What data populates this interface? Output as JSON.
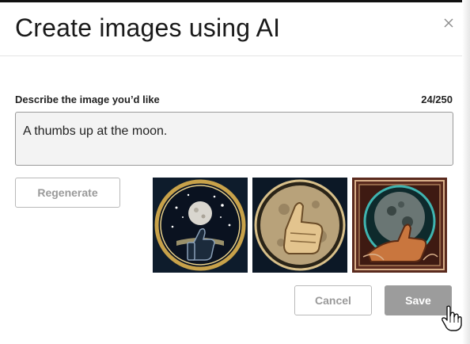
{
  "dialog": {
    "title": "Create images using AI",
    "close_icon": "close-icon"
  },
  "prompt": {
    "label": "Describe the image you’d like",
    "char_count": "24/250",
    "value": "A thumbs up at the moon."
  },
  "actions": {
    "regenerate_label": "Regenerate",
    "cancel_label": "Cancel",
    "save_label": "Save"
  },
  "images": [
    {
      "icon": "thumbs-up-moon-starry-image"
    },
    {
      "icon": "thumbs-up-moon-closeup-image"
    },
    {
      "icon": "thumbs-up-moon-ornate-image"
    }
  ],
  "colors": {
    "title_text": "#1a1a1a",
    "input_background": "#f3f3f3",
    "save_background": "#9c9c9c",
    "disabled_text": "#9a9a9a"
  }
}
